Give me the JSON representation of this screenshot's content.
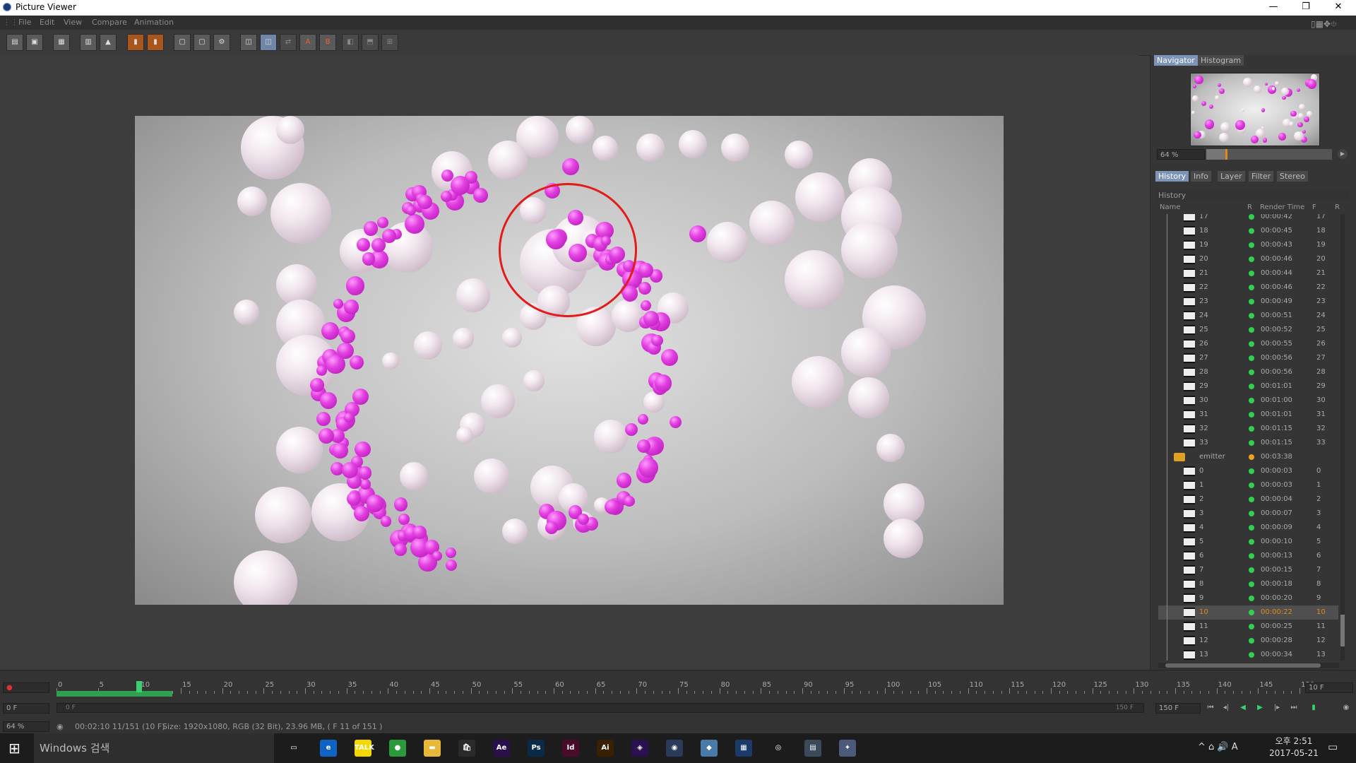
{
  "window": {
    "title": "Picture Viewer",
    "minimize": "—",
    "restore": "❐",
    "close": "✕"
  },
  "menu": [
    "File",
    "Edit",
    "View",
    "Compare",
    "Animation"
  ],
  "toolbar": {
    "icons": [
      "open-icon",
      "save-icon",
      "render-icon",
      "film-icon",
      "export-icon",
      "layer-icon",
      "layer-alt-icon",
      "region-icon",
      "region-alt-icon",
      "settings-icon",
      "compare-a-icon",
      "compare-b-icon",
      "swap-icon",
      "set-a-icon",
      "set-b-icon",
      "split-h-icon",
      "split-v-icon",
      "split-grid-icon"
    ]
  },
  "navigator": {
    "tabs": [
      "Navigator",
      "Histogram"
    ],
    "active_tab": "Navigator",
    "zoom": "64 %",
    "zoom_fraction": 0.17
  },
  "history_panel": {
    "tabs": [
      "History",
      "Info",
      "Layer",
      "Filter",
      "Stereo"
    ],
    "active_tab": "History",
    "heading": "History",
    "columns": [
      "Name",
      "R",
      "Render Time",
      "F",
      "R"
    ],
    "rows": [
      {
        "name": "17",
        "time": "00:00:42",
        "frame": "17",
        "status": "green"
      },
      {
        "name": "18",
        "time": "00:00:45",
        "frame": "18",
        "status": "green"
      },
      {
        "name": "19",
        "time": "00:00:43",
        "frame": "19",
        "status": "green"
      },
      {
        "name": "20",
        "time": "00:00:46",
        "frame": "20",
        "status": "green"
      },
      {
        "name": "21",
        "time": "00:00:44",
        "frame": "21",
        "status": "green"
      },
      {
        "name": "22",
        "time": "00:00:46",
        "frame": "22",
        "status": "green"
      },
      {
        "name": "23",
        "time": "00:00:49",
        "frame": "23",
        "status": "green"
      },
      {
        "name": "24",
        "time": "00:00:51",
        "frame": "24",
        "status": "green"
      },
      {
        "name": "25",
        "time": "00:00:52",
        "frame": "25",
        "status": "green"
      },
      {
        "name": "26",
        "time": "00:00:55",
        "frame": "26",
        "status": "green"
      },
      {
        "name": "27",
        "time": "00:00:56",
        "frame": "27",
        "status": "green"
      },
      {
        "name": "28",
        "time": "00:00:56",
        "frame": "28",
        "status": "green"
      },
      {
        "name": "29",
        "time": "00:01:01",
        "frame": "29",
        "status": "green"
      },
      {
        "name": "30",
        "time": "00:01:00",
        "frame": "30",
        "status": "green"
      },
      {
        "name": "31",
        "time": "00:01:01",
        "frame": "31",
        "status": "green"
      },
      {
        "name": "32",
        "time": "00:01:15",
        "frame": "32",
        "status": "green"
      },
      {
        "name": "33",
        "time": "00:01:15",
        "frame": "33",
        "status": "green"
      },
      {
        "name": "emitter",
        "time": "00:03:38",
        "frame": "",
        "status": "orange",
        "folder": true
      },
      {
        "name": "0",
        "time": "00:00:03",
        "frame": "0",
        "status": "green"
      },
      {
        "name": "1",
        "time": "00:00:03",
        "frame": "1",
        "status": "green"
      },
      {
        "name": "2",
        "time": "00:00:04",
        "frame": "2",
        "status": "green"
      },
      {
        "name": "3",
        "time": "00:00:07",
        "frame": "3",
        "status": "green"
      },
      {
        "name": "4",
        "time": "00:00:09",
        "frame": "4",
        "status": "green"
      },
      {
        "name": "5",
        "time": "00:00:10",
        "frame": "5",
        "status": "green"
      },
      {
        "name": "6",
        "time": "00:00:13",
        "frame": "6",
        "status": "green"
      },
      {
        "name": "7",
        "time": "00:00:15",
        "frame": "7",
        "status": "green"
      },
      {
        "name": "8",
        "time": "00:00:18",
        "frame": "8",
        "status": "green"
      },
      {
        "name": "9",
        "time": "00:00:20",
        "frame": "9",
        "status": "green"
      },
      {
        "name": "10",
        "time": "00:00:22",
        "frame": "10",
        "status": "green",
        "selected": true
      },
      {
        "name": "11",
        "time": "00:00:25",
        "frame": "11",
        "status": "green"
      },
      {
        "name": "12",
        "time": "00:00:28",
        "frame": "12",
        "status": "green"
      },
      {
        "name": "13",
        "time": "00:00:34",
        "frame": "13",
        "status": "green"
      }
    ]
  },
  "timeline": {
    "start_field": "0 F",
    "range_start": "0 F",
    "range_end": "150 F",
    "end_field": "150 F",
    "current_field": "10 F",
    "current_frame": 10,
    "rendered_frames": 14,
    "max_frame": 150,
    "tick_labels": [
      "0",
      "5",
      "10",
      "15",
      "20",
      "25",
      "30",
      "35",
      "40",
      "45",
      "50",
      "55",
      "60",
      "65",
      "70",
      "75",
      "80",
      "85",
      "90",
      "95",
      "100",
      "105",
      "110",
      "115",
      "120",
      "125",
      "130",
      "135",
      "140",
      "145",
      "150"
    ]
  },
  "status": {
    "zoom": "64 %",
    "time": "00:02:10 11/151 (10 F)",
    "info": "Size: 1920x1080, RGB (32 Bit), 23.96 MB,  ( F 11 of 151 )"
  },
  "taskbar": {
    "search": "Windows 검색",
    "apps": [
      {
        "name": "task-view",
        "label": "▭",
        "color": "#1c1c1c"
      },
      {
        "name": "edge",
        "label": "e",
        "color": "#0f63c4"
      },
      {
        "name": "kakaotalk",
        "label": "TALK",
        "color": "#f5d800"
      },
      {
        "name": "chrome",
        "label": "●",
        "color": "#2a9a3a"
      },
      {
        "name": "file-explorer",
        "label": "▬",
        "color": "#e8b83a"
      },
      {
        "name": "store",
        "label": "🛍",
        "color": "#2a2a2a"
      },
      {
        "name": "after-effects",
        "label": "Ae",
        "color": "#2a0f4a"
      },
      {
        "name": "photoshop",
        "label": "Ps",
        "color": "#0a2a4a"
      },
      {
        "name": "indesign",
        "label": "Id",
        "color": "#4a0a2a"
      },
      {
        "name": "illustrator",
        "label": "Ai",
        "color": "#3a1f00"
      },
      {
        "name": "premiere",
        "label": "◈",
        "color": "#2a1050"
      },
      {
        "name": "cinema4d",
        "label": "◉",
        "color": "#2a3a5a"
      },
      {
        "name": "notepad",
        "label": "◆",
        "color": "#4a7aa8"
      },
      {
        "name": "monitor",
        "label": "▦",
        "color": "#1a3a6a"
      },
      {
        "name": "media",
        "label": "◎",
        "color": "#1c1c1c"
      },
      {
        "name": "remote",
        "label": "▤",
        "color": "#3a4a5a"
      },
      {
        "name": "picture-viewer",
        "label": "✦",
        "color": "#4a5a7a"
      }
    ],
    "tray": "^  ⌂  🔊  A",
    "time": "오후 2:51",
    "date": "2017-05-21"
  }
}
